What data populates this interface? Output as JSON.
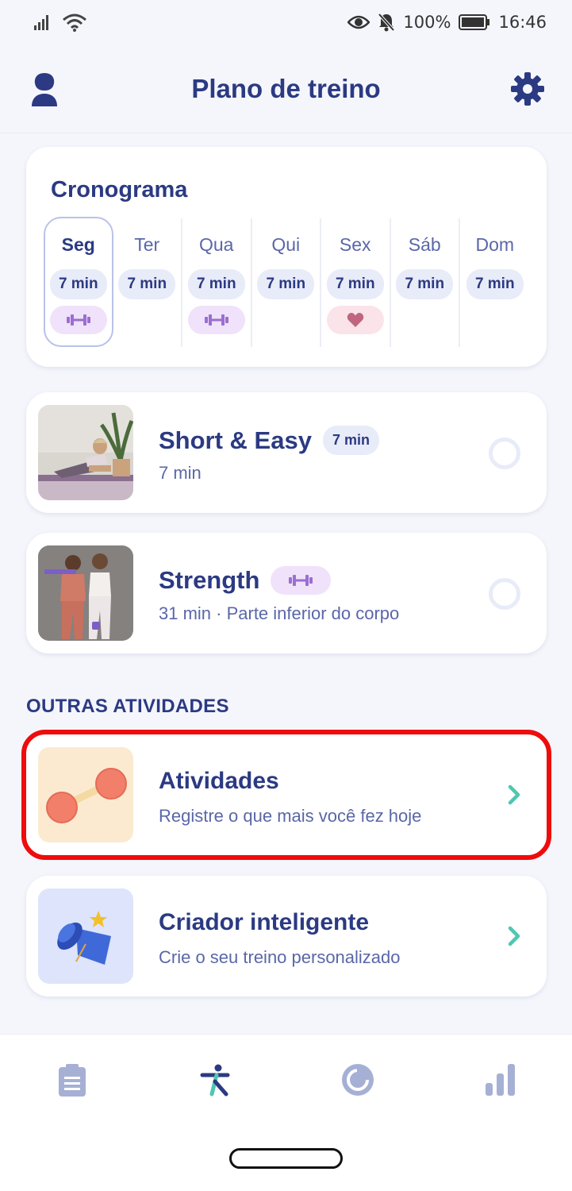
{
  "status_bar": {
    "battery": "100%",
    "time": "16:46"
  },
  "header": {
    "title": "Plano de treino"
  },
  "schedule": {
    "title": "Cronograma",
    "days": [
      {
        "name": "Seg",
        "duration": "7 min",
        "tag": "strength-icon"
      },
      {
        "name": "Ter",
        "duration": "7 min",
        "tag": null
      },
      {
        "name": "Qua",
        "duration": "7 min",
        "tag": "strength-icon"
      },
      {
        "name": "Qui",
        "duration": "7 min",
        "tag": null
      },
      {
        "name": "Sex",
        "duration": "7 min",
        "tag": "heart-icon"
      },
      {
        "name": "Sáb",
        "duration": "7 min",
        "tag": null
      },
      {
        "name": "Dom",
        "duration": "7 min",
        "tag": null
      }
    ]
  },
  "workouts": [
    {
      "title": "Short & Easy",
      "badge": "7 min",
      "subtitle": "7 min"
    },
    {
      "title": "Strength",
      "badge_icon": "strength-icon",
      "subtitle": "31 min · Parte inferior do corpo"
    }
  ],
  "other_activities": {
    "label": "OUTRAS ATIVIDADES",
    "items": [
      {
        "title": "Atividades",
        "subtitle": "Registre o que mais você fez hoje"
      },
      {
        "title": "Criador inteligente",
        "subtitle": "Crie o seu treino personalizado"
      }
    ]
  },
  "colors": {
    "primary": "#2b3a82",
    "accent": "#4fc7b0",
    "highlight": "#ee0c0c",
    "strength_tag": "#efe2fa",
    "heart_tag": "#fbe3ea"
  }
}
